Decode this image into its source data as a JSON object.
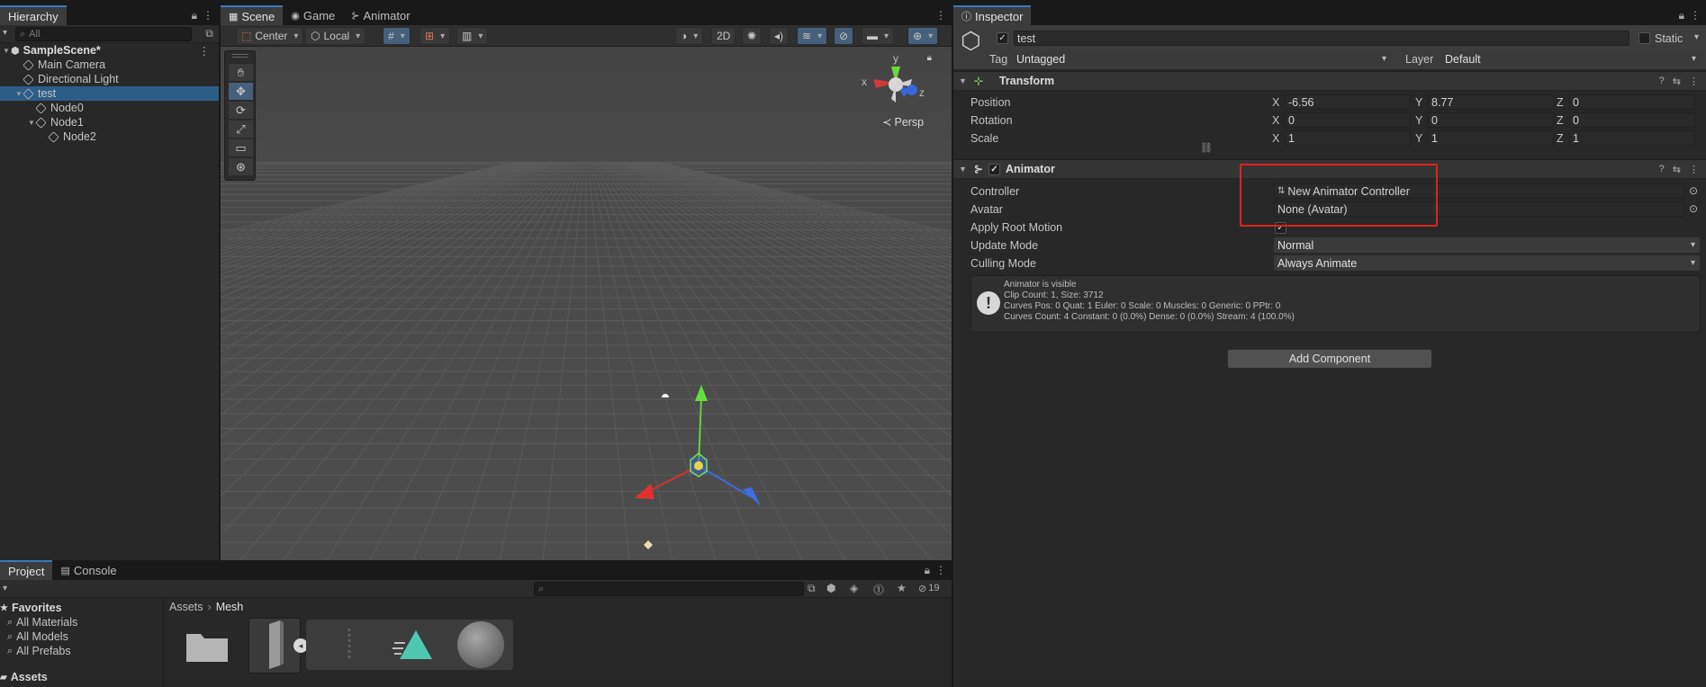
{
  "hierarchy": {
    "tab": "Hierarchy",
    "search_placeholder": "All",
    "items": [
      {
        "label": "SampleScene*",
        "indent": 0,
        "scene": true,
        "expanded": true
      },
      {
        "label": "Main Camera",
        "indent": 1
      },
      {
        "label": "Directional Light",
        "indent": 1
      },
      {
        "label": "test",
        "indent": 1,
        "selected": true,
        "expanded": true
      },
      {
        "label": "Node0",
        "indent": 2
      },
      {
        "label": "Node1",
        "indent": 2,
        "expanded": true
      },
      {
        "label": "Node2",
        "indent": 3
      }
    ]
  },
  "scene_view": {
    "tabs": [
      "Scene",
      "Game",
      "Animator"
    ],
    "active_tab": "Scene",
    "pivot_mode": "Center",
    "pivot_rotation": "Local",
    "mode_2d": "2D",
    "camera_label": "Persp",
    "axes": {
      "x": "x",
      "y": "y",
      "z": "z"
    },
    "tools": [
      "hand-icon",
      "move-icon",
      "rotate-icon",
      "scale-icon",
      "rect-icon",
      "transform-icon"
    ]
  },
  "inspector": {
    "tab": "Inspector",
    "object_name": "test",
    "static_label": "Static",
    "tag_label": "Tag",
    "tag_value": "Untagged",
    "layer_label": "Layer",
    "layer_value": "Default",
    "transform": {
      "title": "Transform",
      "rows": [
        {
          "label": "Position",
          "x": "-6.56",
          "y": "8.77",
          "z": "0"
        },
        {
          "label": "Rotation",
          "x": "0",
          "y": "0",
          "z": "0"
        },
        {
          "label": "Scale",
          "x": "1",
          "y": "1",
          "z": "1"
        }
      ]
    },
    "animator": {
      "title": "Animator",
      "controller_label": "Controller",
      "controller_value": "New Animator Controller",
      "avatar_label": "Avatar",
      "avatar_value": "None (Avatar)",
      "apply_root_motion_label": "Apply Root Motion",
      "update_mode_label": "Update Mode",
      "update_mode_value": "Normal",
      "culling_mode_label": "Culling Mode",
      "culling_mode_value": "Always Animate",
      "info_lines": [
        "Animator is visible",
        "Clip Count: 1, Size: 3712",
        "Curves Pos: 0 Quat: 1 Euler: 0 Scale: 0 Muscles: 0 Generic: 0 PPtr: 0",
        "Curves Count: 4 Constant: 0 (0.0%) Dense: 0 (0.0%) Stream: 4 (100.0%)"
      ]
    },
    "add_component": "Add Component",
    "highlight_color": "#e0221f"
  },
  "project": {
    "tabs": [
      "Project",
      "Console"
    ],
    "favorites_label": "Favorites",
    "favorites": [
      "All Materials",
      "All Models",
      "All Prefabs"
    ],
    "assets_label": "Assets",
    "breadcrumb": [
      "Assets",
      "Mesh"
    ],
    "hidden_count": "19"
  },
  "colors": {
    "accent": "#3a79bb",
    "selection": "#2c5d87",
    "scene_bg": "#4a4a4a"
  }
}
